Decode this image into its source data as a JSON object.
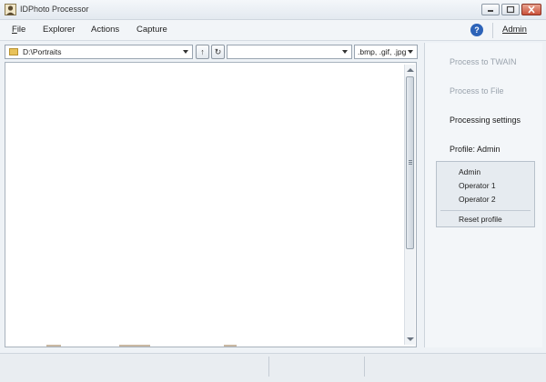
{
  "window": {
    "title": "IDPhoto Processor",
    "icons": {
      "app": "person-photo-icon",
      "minimize": "minimize-icon",
      "maximize": "maximize-icon",
      "close": "close-icon"
    }
  },
  "menu": {
    "items": [
      "File",
      "Explorer",
      "Actions",
      "Capture"
    ],
    "help_icon": "?",
    "user_label": "Admin"
  },
  "toolbar": {
    "path": "D:\\Portraits",
    "up_glyph": "↑",
    "refresh_glyph": "↻",
    "search_value": "",
    "filter": ".bmp, .gif, .jpg"
  },
  "side_panel": {
    "links": [
      {
        "label": "Process to TWAIN",
        "state": "disabled"
      },
      {
        "label": "Process to File",
        "state": "disabled"
      },
      {
        "label": "Processing settings",
        "state": "active"
      }
    ],
    "profile_label": "Profile: Admin",
    "profiles": [
      "Admin",
      "Operator 1",
      "Operator 2"
    ],
    "reset_label": "Reset profile"
  },
  "status": {
    "cells": [
      "",
      "",
      ""
    ]
  },
  "colors": {
    "accent": "#2d63b8",
    "disabled_text": "#9aa3ad",
    "close_button": "#c9503a"
  }
}
